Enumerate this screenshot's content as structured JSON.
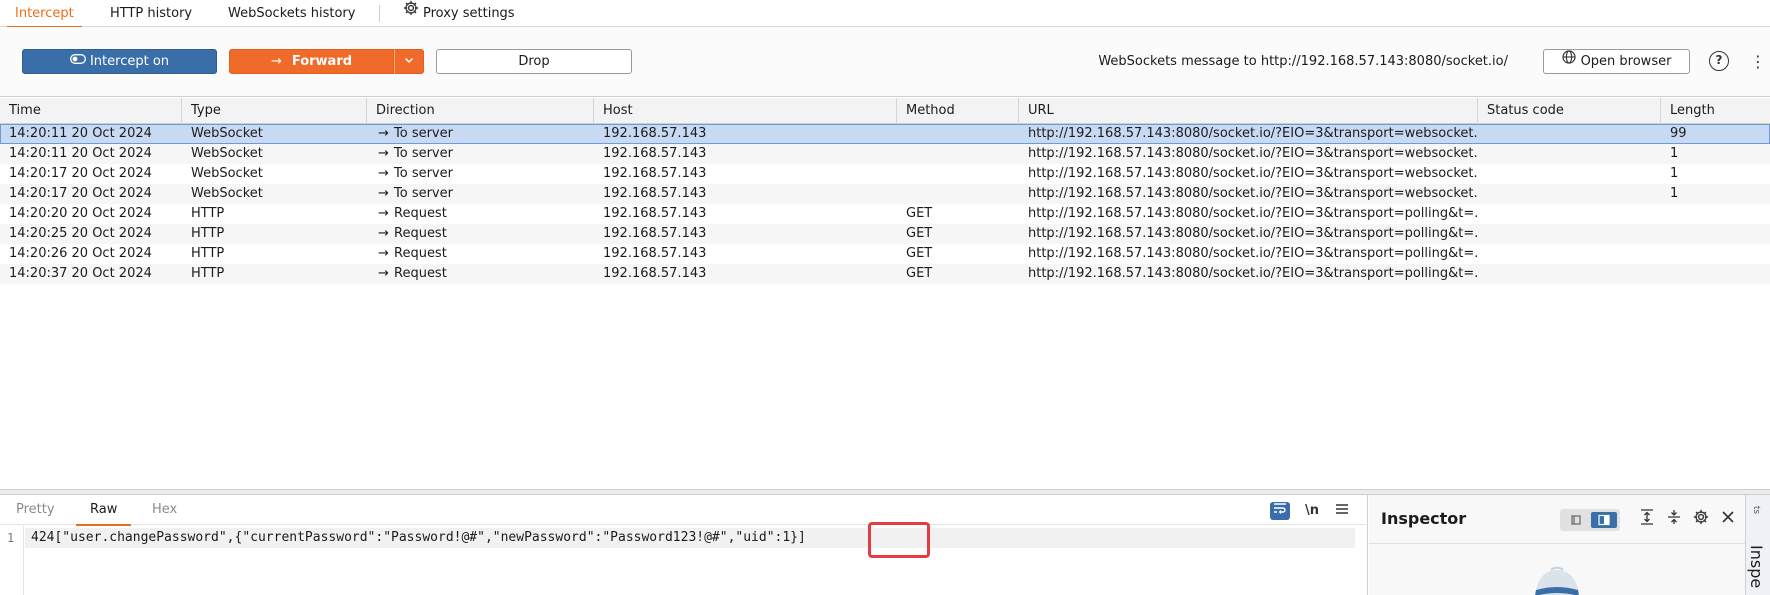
{
  "top_tabs": [
    {
      "label": "Intercept",
      "active": true
    },
    {
      "label": "HTTP history",
      "active": false
    },
    {
      "label": "WebSockets history",
      "active": false
    }
  ],
  "proxy_settings_label": "Proxy settings",
  "toolbar": {
    "intercept_label": "Intercept on",
    "forward_label": "Forward",
    "drop_label": "Drop",
    "ws_message": "WebSockets message to http://192.168.57.143:8080/socket.io/",
    "open_browser_label": "Open browser",
    "help_glyph": "?",
    "menu_glyph": "⋮"
  },
  "table": {
    "columns": [
      "Time",
      "Type",
      "Direction",
      "Host",
      "Method",
      "URL",
      "Status code",
      "Length"
    ],
    "rows": [
      {
        "time": "14:20:11 20 Oct 2024",
        "type": "WebSocket",
        "direction": "To server",
        "host": "192.168.57.143",
        "method": "",
        "url": "http://192.168.57.143:8080/socket.io/?EIO=3&transport=websocket...",
        "status": "",
        "length": "99",
        "selected": true
      },
      {
        "time": "14:20:11 20 Oct 2024",
        "type": "WebSocket",
        "direction": "To server",
        "host": "192.168.57.143",
        "method": "",
        "url": "http://192.168.57.143:8080/socket.io/?EIO=3&transport=websocket...",
        "status": "",
        "length": "1",
        "selected": false
      },
      {
        "time": "14:20:17 20 Oct 2024",
        "type": "WebSocket",
        "direction": "To server",
        "host": "192.168.57.143",
        "method": "",
        "url": "http://192.168.57.143:8080/socket.io/?EIO=3&transport=websocket...",
        "status": "",
        "length": "1",
        "selected": false
      },
      {
        "time": "14:20:17 20 Oct 2024",
        "type": "WebSocket",
        "direction": "To server",
        "host": "192.168.57.143",
        "method": "",
        "url": "http://192.168.57.143:8080/socket.io/?EIO=3&transport=websocket...",
        "status": "",
        "length": "1",
        "selected": false
      },
      {
        "time": "14:20:20 20 Oct 2024",
        "type": "HTTP",
        "direction": "Request",
        "host": "192.168.57.143",
        "method": "GET",
        "url": "http://192.168.57.143:8080/socket.io/?EIO=3&transport=polling&t=...",
        "status": "",
        "length": "",
        "selected": false
      },
      {
        "time": "14:20:25 20 Oct 2024",
        "type": "HTTP",
        "direction": "Request",
        "host": "192.168.57.143",
        "method": "GET",
        "url": "http://192.168.57.143:8080/socket.io/?EIO=3&transport=polling&t=...",
        "status": "",
        "length": "",
        "selected": false
      },
      {
        "time": "14:20:26 20 Oct 2024",
        "type": "HTTP",
        "direction": "Request",
        "host": "192.168.57.143",
        "method": "GET",
        "url": "http://192.168.57.143:8080/socket.io/?EIO=3&transport=polling&t=...",
        "status": "",
        "length": "",
        "selected": false
      },
      {
        "time": "14:20:37 20 Oct 2024",
        "type": "HTTP",
        "direction": "Request",
        "host": "192.168.57.143",
        "method": "GET",
        "url": "http://192.168.57.143:8080/socket.io/?EIO=3&transport=polling&t=...",
        "status": "",
        "length": "",
        "selected": false
      }
    ]
  },
  "editor": {
    "tabs": [
      {
        "label": "Pretty",
        "active": false
      },
      {
        "label": "Raw",
        "active": true
      },
      {
        "label": "Hex",
        "active": false
      }
    ],
    "newline_toggle_label": "\\n",
    "line_number": "1",
    "content": "424[\"user.changePassword\",{\"currentPassword\":\"Password!@#\",\"newPassword\":\"Password123!@#\",\"uid\":1}]"
  },
  "inspector": {
    "title": "Inspector",
    "side_label": "Inspe",
    "side_small": "ts"
  },
  "colors": {
    "accent_orange": "#f06b2a",
    "intercept_blue": "#3a6ea8",
    "selected_row": "#c8daf3",
    "highlight_red": "#e53b45"
  },
  "icons": [
    "settings-gear-icon",
    "toggle-icon",
    "forward-arrow-icon",
    "chevron-down-icon",
    "globe-icon",
    "help-icon",
    "kebab-menu-icon",
    "wrap-lines-icon",
    "hamburger-menu-icon",
    "expand-icon",
    "collapse-icon",
    "gear-icon",
    "close-icon",
    "hat-icon"
  ]
}
